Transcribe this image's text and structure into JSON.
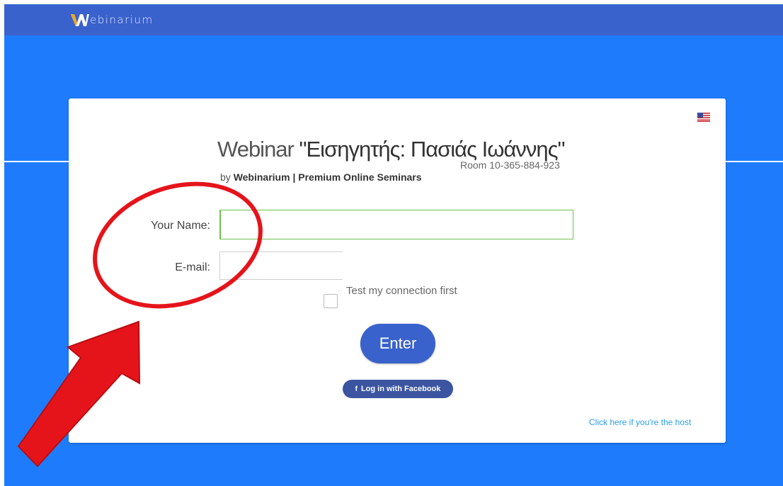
{
  "app": {
    "logo_text": "ebinarium"
  },
  "webinar": {
    "title_prefix": "Webinar",
    "title_name": "\"Εισηγητής: Πασιάς Ιωάννης\"",
    "room": "Room 10-365-884-923",
    "by_prefix": "by",
    "organizer": "Webinarium | Premium Online Seminars"
  },
  "form": {
    "name_label": "Your Name:",
    "name_value": "",
    "email_label": "E-mail:",
    "email_value": "",
    "test_label": "Test my connection first",
    "enter_label": "Enter",
    "facebook_label": "Log in with Facebook",
    "facebook_icon": "f",
    "host_link": "Click here if you're the host"
  },
  "icons": {
    "flag": "us-flag-icon"
  },
  "colors": {
    "background": "#1e7cfc",
    "topbar": "#3a62cc",
    "button": "#3a62cc",
    "facebook": "#3b55a0",
    "link": "#2c9ee8",
    "annotation": "#e5141b"
  }
}
